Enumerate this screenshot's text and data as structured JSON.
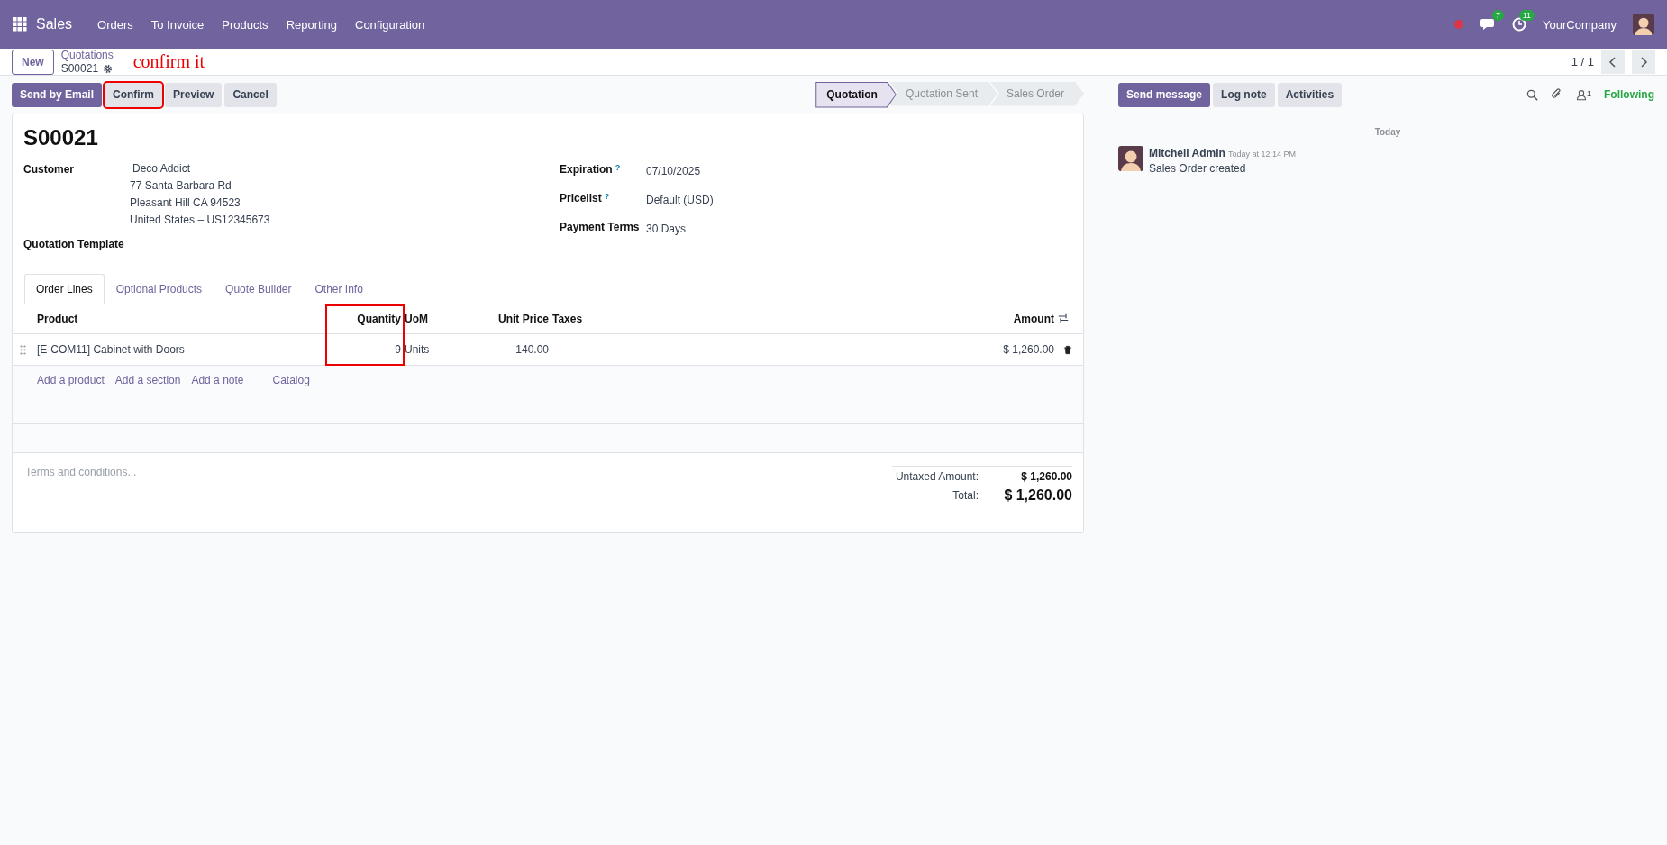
{
  "navbar": {
    "app": "Sales",
    "menu": [
      "Orders",
      "To Invoice",
      "Products",
      "Reporting",
      "Configuration"
    ],
    "messages_count": "7",
    "activities_count": "11",
    "company": "YourCompany"
  },
  "breadcrumb": {
    "new_button": "New",
    "parent": "Quotations",
    "current": "S00021"
  },
  "annotation": "confirm it",
  "pager": "1 / 1",
  "actions": [
    {
      "label": "Send by Email",
      "kind": "primary",
      "highlighted": false
    },
    {
      "label": "Confirm",
      "kind": "secondary",
      "highlighted": true
    },
    {
      "label": "Preview",
      "kind": "secondary",
      "highlighted": false
    },
    {
      "label": "Cancel",
      "kind": "secondary",
      "highlighted": false
    }
  ],
  "status_steps": [
    {
      "label": "Quotation",
      "selected": true
    },
    {
      "label": "Quotation Sent",
      "selected": false
    },
    {
      "label": "Sales Order",
      "selected": false
    }
  ],
  "form": {
    "title": "S00021",
    "left_fields": [
      {
        "label": "Customer",
        "lines": [
          "Deco Addict",
          "77 Santa Barbara Rd",
          "Pleasant Hill CA 94523",
          "United States – US12345673"
        ]
      },
      {
        "label": "Quotation Template"
      }
    ],
    "right_fields": [
      {
        "label": "Expiration",
        "help": "?",
        "value": "07/10/2025"
      },
      {
        "label": "Pricelist",
        "help": "?",
        "value": "Default (USD)"
      },
      {
        "label": "Payment Terms",
        "value": "30 Days"
      }
    ],
    "tabs": [
      {
        "label": "Order Lines",
        "selected": true
      },
      {
        "label": "Optional Products",
        "selected": false
      },
      {
        "label": "Quote Builder",
        "selected": false
      },
      {
        "label": "Other Info",
        "selected": false
      }
    ],
    "order_lines": {
      "columns": [
        {
          "label": "Product",
          "highlighted": false
        },
        {
          "label": "Quantity",
          "highlighted": true
        },
        {
          "label": "UoM",
          "highlighted": false
        },
        {
          "label": "Unit Price",
          "highlighted": false
        },
        {
          "label": "Taxes",
          "highlighted": false
        },
        {
          "label": "Amount",
          "highlighted": false
        }
      ],
      "rows": [
        {
          "product": "[E-COM11] Cabinet with Doors",
          "quantity": "9",
          "uom": "Units",
          "unit_price": "140.00",
          "amount": "$ 1,260.00"
        }
      ],
      "add_links": [
        "Add a product",
        "Add a section",
        "Add a note",
        "Catalog"
      ]
    },
    "terms_placeholder": "Terms and conditions...",
    "totals": [
      {
        "label": "Untaxed Amount:",
        "value": "$ 1,260.00",
        "kind": "subtotal"
      },
      {
        "label": "Total:",
        "value": "$ 1,260.00",
        "kind": "total"
      }
    ]
  },
  "chatter": {
    "buttons": [
      {
        "label": "Send message",
        "kind": "primary"
      },
      {
        "label": "Log note",
        "kind": "secondary"
      },
      {
        "label": "Activities",
        "kind": "secondary"
      }
    ],
    "follower_count": "1",
    "follow_label": "Following",
    "date_separator": "Today",
    "messages": [
      {
        "author": "Mitchell Admin",
        "time": "Today at 12:14 PM",
        "body": "Sales Order created"
      }
    ]
  }
}
